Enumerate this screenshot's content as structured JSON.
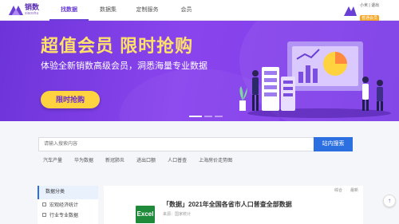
{
  "header": {
    "logo_name": "销数",
    "logo_sub": "xiaoshu",
    "nav": [
      "找数据",
      "数据集",
      "定制服务",
      "会员"
    ],
    "user_line1": "小米 | 退出",
    "user_badge": "普通会员"
  },
  "banner": {
    "title": "超值会员 限时抢购",
    "subtitle": "体验全新销数高级会员，洞悉海量专业数据",
    "cta": "限时抢购"
  },
  "search": {
    "placeholder": "请输入搜索内容",
    "button": "站内搜索",
    "quick_links": [
      "汽车产量",
      "华为数据",
      "新冠肺炎",
      "进出口额",
      "人口普查",
      "上海房价走势图"
    ]
  },
  "sidebar": {
    "title": "数据分类",
    "items": [
      "宏观经济统计",
      "行业专业数据"
    ]
  },
  "content": {
    "sort": [
      "综合",
      "最新"
    ],
    "result_icon": "Excel",
    "result_title": "「数据」2021年全国各省市人口普查全部数据",
    "result_meta": "来源：国家统计"
  },
  "colors": {
    "brand": "#6a3fd6",
    "banner_title": "#ffe06b",
    "cta_bg": "#ffd23f",
    "search_button": "#2b6fe0",
    "excel": "#1f8b3a"
  }
}
